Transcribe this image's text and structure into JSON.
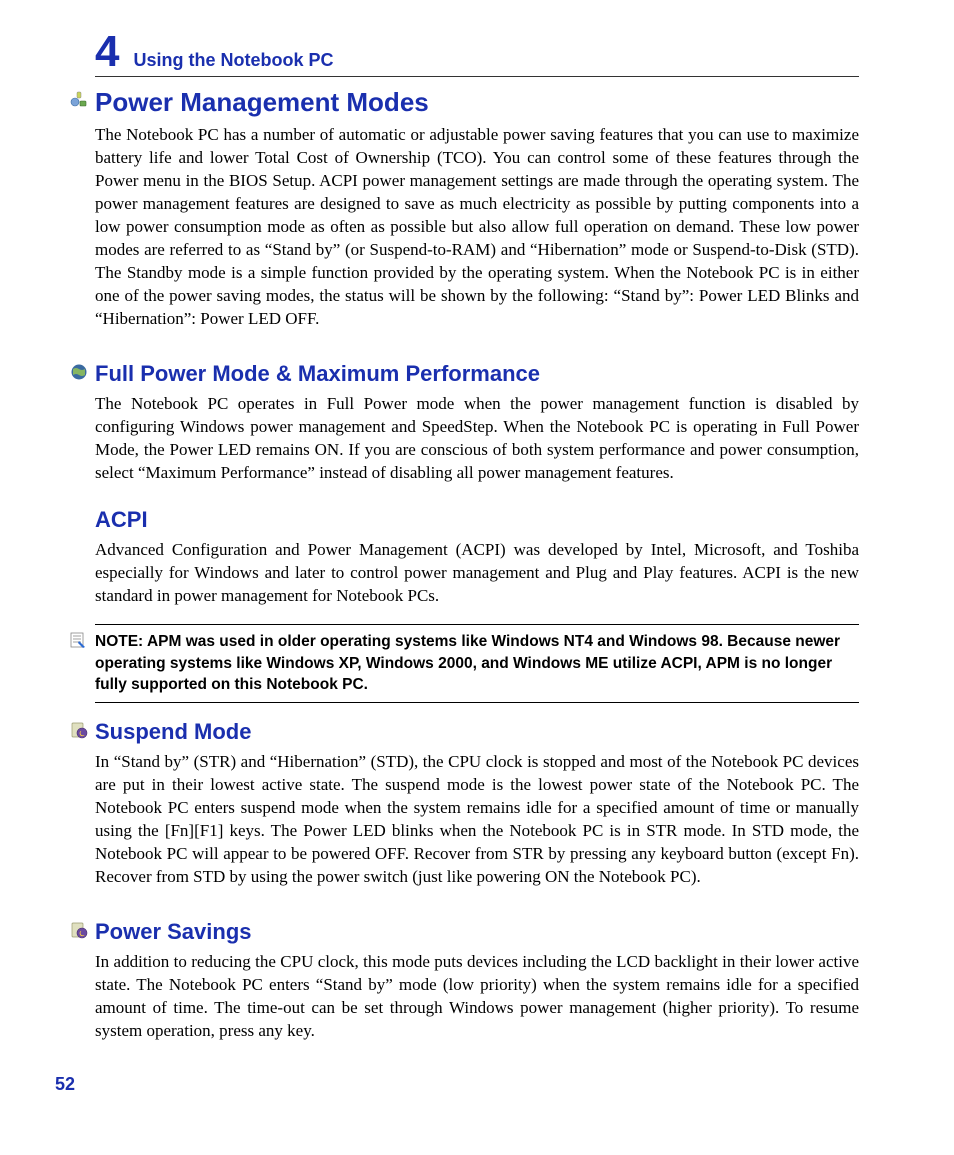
{
  "chapter": {
    "number": "4",
    "title": "Using the Notebook PC"
  },
  "heading1": "Power Management Modes",
  "para1": "The Notebook PC has a number of automatic or adjustable power saving features that you can use to maximize battery life and lower Total Cost of Ownership (TCO). You can control some of these features through the Power menu in the BIOS Setup. ACPI power management settings are made through the operating system. The power management features are designed to save as much electricity as possible by putting components into a low power consumption mode as often as possible but also allow full operation on demand. These low power modes are referred to as “Stand by” (or Suspend-to-RAM) and “Hibernation” mode or Suspend-to-Disk (STD). The Standby mode is a simple function provided by the operating system. When the Notebook PC is in either one of the power saving modes, the status will be shown by the following: “Stand by”: Power LED Blinks and “Hibernation”: Power LED OFF.",
  "heading2": "Full Power Mode & Maximum Performance",
  "para2": "The Notebook PC operates in Full Power mode when the power management function is disabled by configuring Windows power management and SpeedStep. When the Notebook PC is operating in Full Power Mode, the Power LED remains ON. If you are conscious of both system performance and power consumption, select “Maximum Performance” instead of disabling all power management features.",
  "heading3": "ACPI",
  "para3": "Advanced Configuration and Power Management (ACPI) was developed by Intel, Microsoft, and Toshiba especially for Windows and later to control power management and Plug and Play features. ACPI is the new standard in power management for Notebook PCs.",
  "note": "NOTE: APM was used in older operating systems like Windows NT4 and Windows 98. Because newer operating systems like Windows XP, Windows 2000, and Windows ME utilize ACPI, APM is no longer fully supported on this Notebook PC.",
  "heading4": "Suspend Mode",
  "para4": "In “Stand by” (STR) and “Hibernation” (STD), the CPU clock is stopped and most of the Notebook PC devices are put in their lowest active state. The suspend mode is the lowest power state of the Notebook PC. The Notebook PC enters suspend mode when the system remains idle for a specified amount of time or manually using the [Fn][F1] keys. The Power LED blinks when the Notebook PC is in STR mode. In STD mode, the Notebook PC will appear to be powered OFF. Recover from STR by pressing any keyboard button (except Fn). Recover from STD by using the power switch (just like powering ON the Notebook PC).",
  "heading5": "Power Savings",
  "para5": "In addition to reducing the CPU clock, this mode puts devices including the LCD backlight in their lower active state. The Notebook PC enters “Stand by” mode (low priority) when the system remains idle for a specified amount of time. The time-out can be set through Windows power management (higher priority). To resume system operation, press any key.",
  "pageNumber": "52"
}
